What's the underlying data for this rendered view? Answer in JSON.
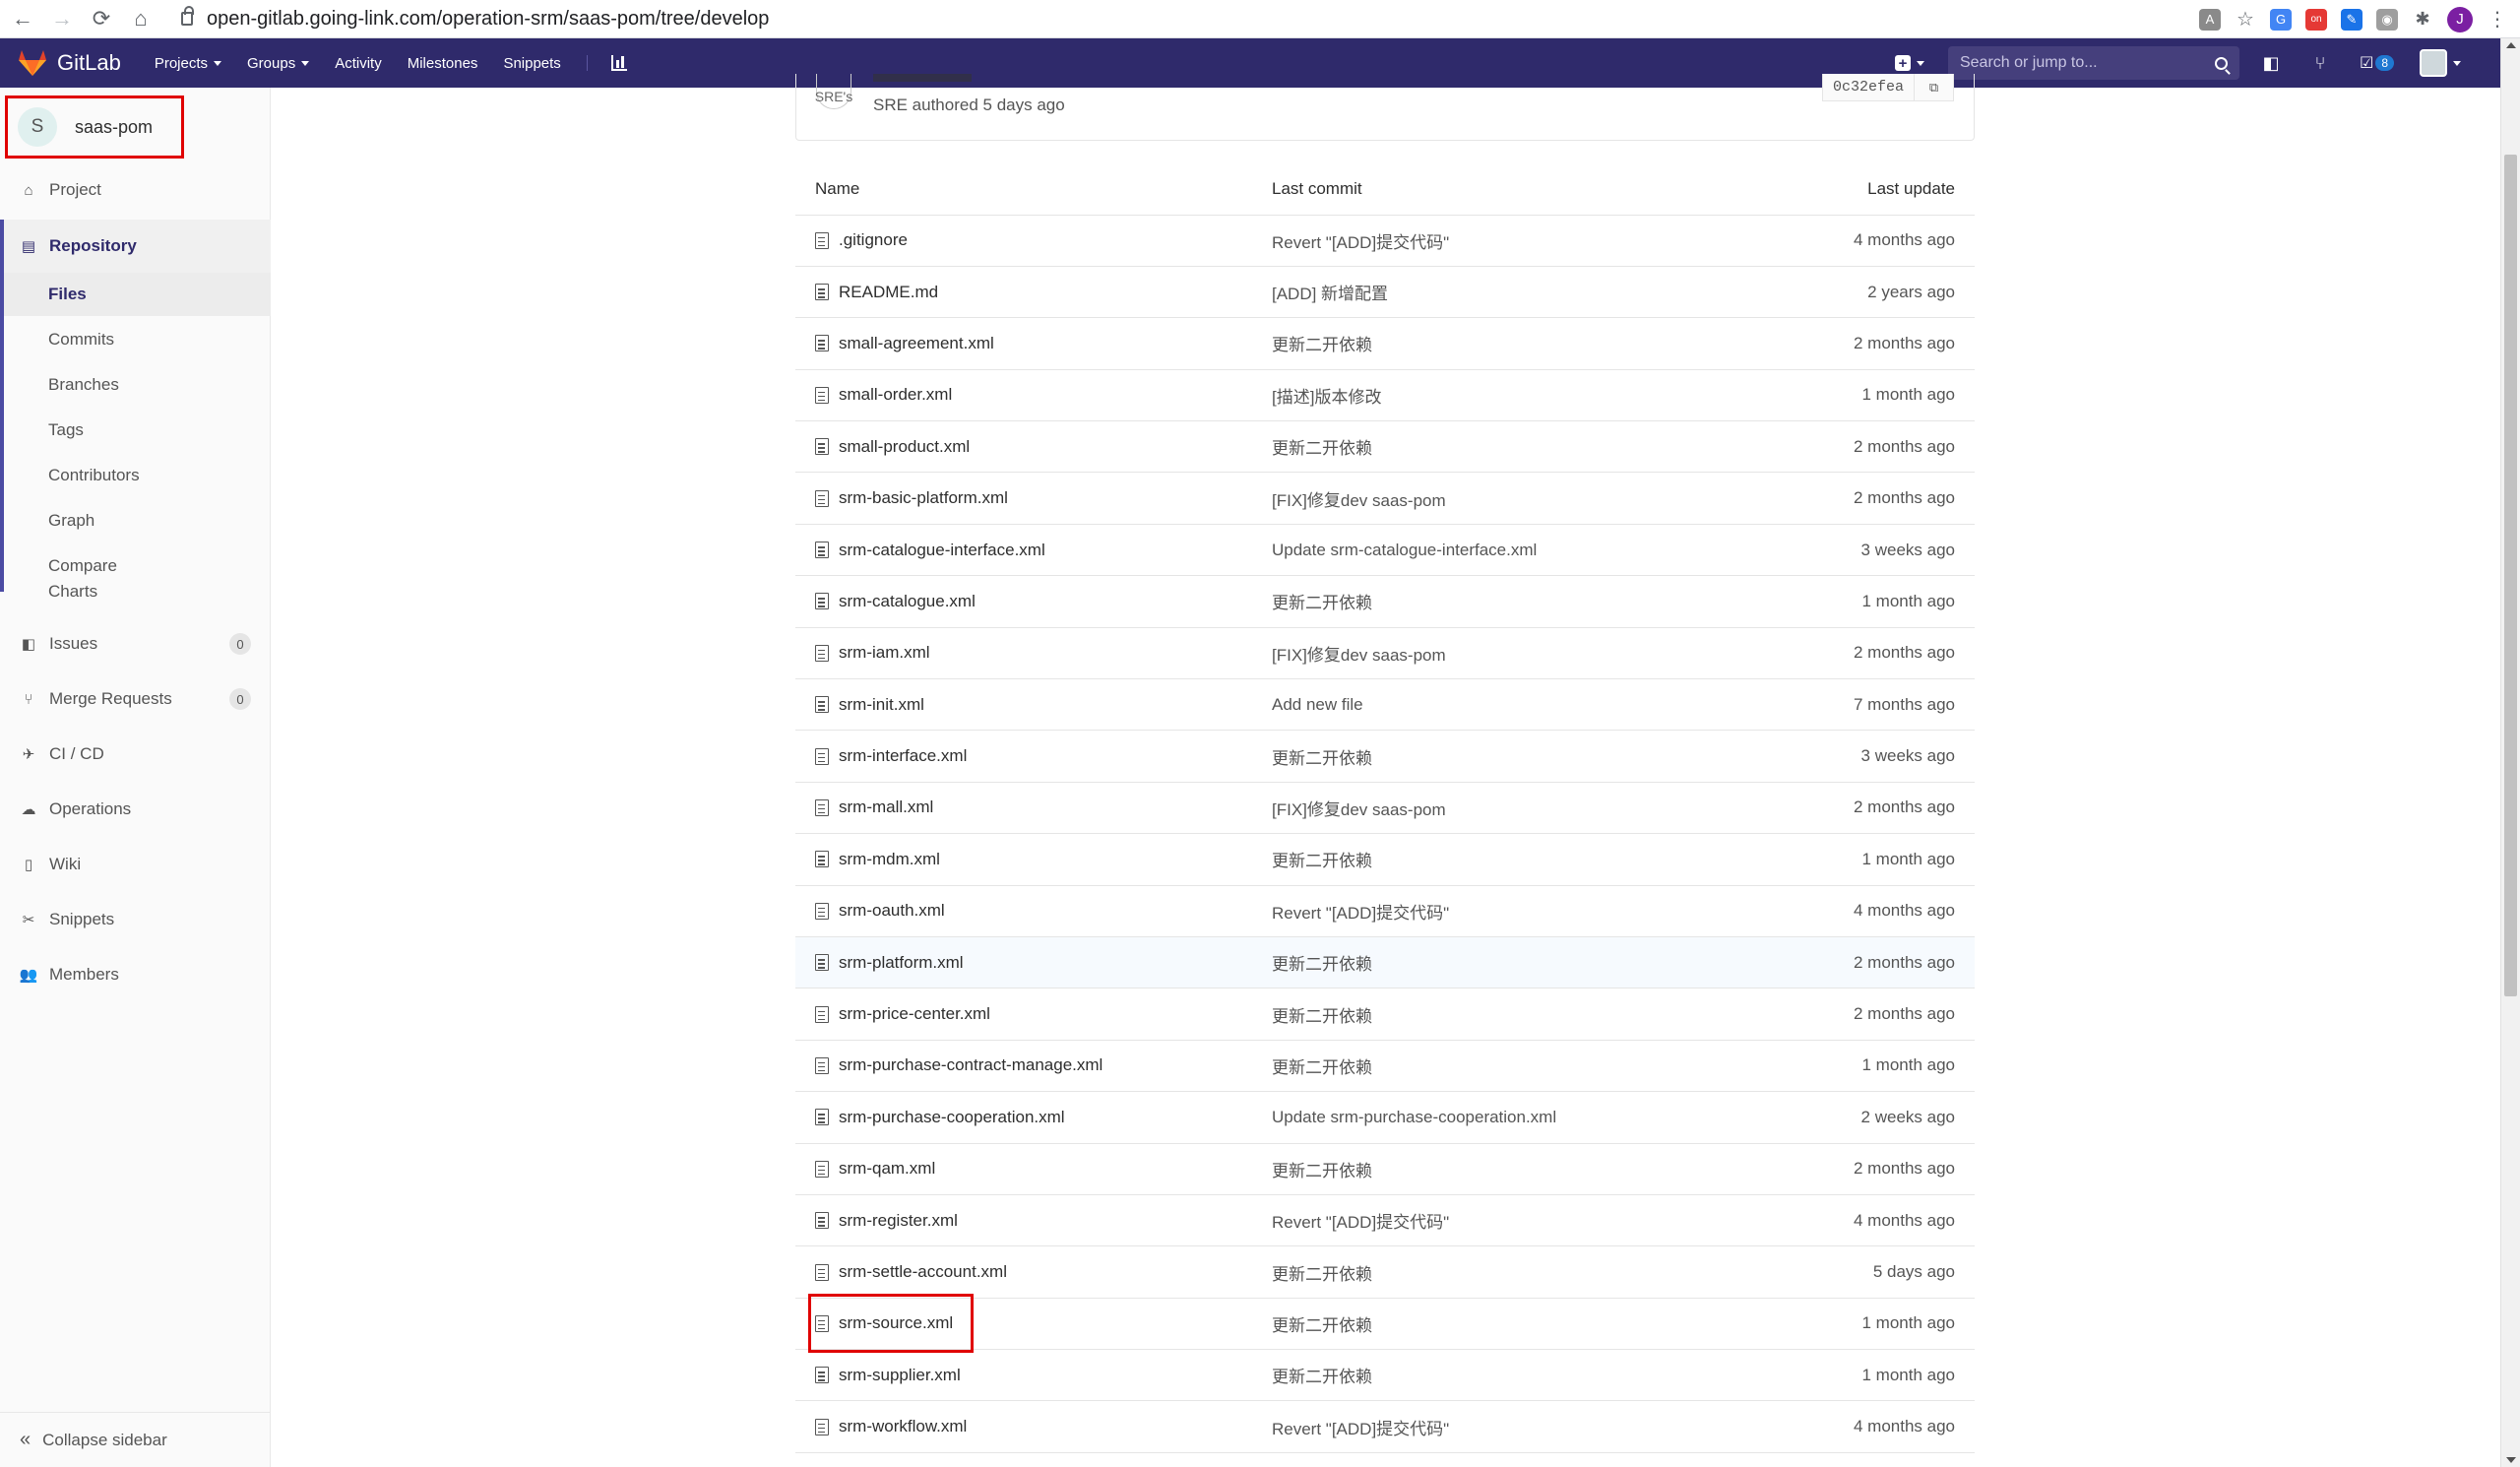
{
  "browser": {
    "back": "←",
    "forward": "→",
    "reload": "⟳",
    "home": "⌂",
    "url": "open-gitlab.going-link.com/operation-srm/saas-pom/tree/develop",
    "user_initial": "J"
  },
  "navbar": {
    "logo_text": "GitLab",
    "menu": [
      {
        "label": "Projects"
      },
      {
        "label": "Groups"
      },
      {
        "label": "Activity"
      },
      {
        "label": "Milestones"
      },
      {
        "label": "Snippets"
      }
    ],
    "search_placeholder": "Search or jump to...",
    "todo_count": "8",
    "brand_color": "#2f2a6b"
  },
  "sidebar": {
    "project_initial": "S",
    "project_name": "saas-pom",
    "items": {
      "project": "Project",
      "repository": "Repository",
      "issues": "Issues",
      "issues_count": "0",
      "merge_requests": "Merge Requests",
      "merge_requests_count": "0",
      "cicd": "CI / CD",
      "operations": "Operations",
      "wiki": "Wiki",
      "snippets": "Snippets",
      "members": "Members"
    },
    "repo_sub": [
      "Files",
      "Commits",
      "Branches",
      "Tags",
      "Contributors",
      "Graph",
      "Compare",
      "Charts"
    ],
    "collapse": "Collapse sidebar"
  },
  "commit": {
    "avatar": "SRE's",
    "meta": "SRE authored 5 days ago",
    "sha": "0c32efea"
  },
  "table": {
    "headers": {
      "name": "Name",
      "last_commit": "Last commit",
      "last_update": "Last update"
    },
    "rows": [
      {
        "name": ".gitignore",
        "commit": "Revert \"[ADD]提交代码\"",
        "updated": "4 months ago"
      },
      {
        "name": "README.md",
        "commit": "[ADD] 新增配置",
        "updated": "2 years ago"
      },
      {
        "name": "small-agreement.xml",
        "commit": "更新二开依赖",
        "updated": "2 months ago"
      },
      {
        "name": "small-order.xml",
        "commit": "[描述]版本修改",
        "updated": "1 month ago"
      },
      {
        "name": "small-product.xml",
        "commit": "更新二开依赖",
        "updated": "2 months ago"
      },
      {
        "name": "srm-basic-platform.xml",
        "commit": "[FIX]修复dev saas-pom",
        "updated": "2 months ago"
      },
      {
        "name": "srm-catalogue-interface.xml",
        "commit": "Update srm-catalogue-interface.xml",
        "updated": "3 weeks ago"
      },
      {
        "name": "srm-catalogue.xml",
        "commit": "更新二开依赖",
        "updated": "1 month ago"
      },
      {
        "name": "srm-iam.xml",
        "commit": "[FIX]修复dev saas-pom",
        "updated": "2 months ago"
      },
      {
        "name": "srm-init.xml",
        "commit": "Add new file",
        "updated": "7 months ago"
      },
      {
        "name": "srm-interface.xml",
        "commit": "更新二开依赖",
        "updated": "3 weeks ago"
      },
      {
        "name": "srm-mall.xml",
        "commit": "[FIX]修复dev saas-pom",
        "updated": "2 months ago"
      },
      {
        "name": "srm-mdm.xml",
        "commit": "更新二开依赖",
        "updated": "1 month ago"
      },
      {
        "name": "srm-oauth.xml",
        "commit": "Revert \"[ADD]提交代码\"",
        "updated": "4 months ago"
      },
      {
        "name": "srm-platform.xml",
        "commit": "更新二开依赖",
        "updated": "2 months ago"
      },
      {
        "name": "srm-price-center.xml",
        "commit": "更新二开依赖",
        "updated": "2 months ago"
      },
      {
        "name": "srm-purchase-contract-manage.xml",
        "commit": "更新二开依赖",
        "updated": "1 month ago"
      },
      {
        "name": "srm-purchase-cooperation.xml",
        "commit": "Update srm-purchase-cooperation.xml",
        "updated": "2 weeks ago"
      },
      {
        "name": "srm-qam.xml",
        "commit": "更新二开依赖",
        "updated": "2 months ago"
      },
      {
        "name": "srm-register.xml",
        "commit": "Revert \"[ADD]提交代码\"",
        "updated": "4 months ago"
      },
      {
        "name": "srm-settle-account.xml",
        "commit": "更新二开依赖",
        "updated": "5 days ago"
      },
      {
        "name": "srm-source.xml",
        "commit": "更新二开依赖",
        "updated": "1 month ago"
      },
      {
        "name": "srm-supplier.xml",
        "commit": "更新二开依赖",
        "updated": "1 month ago"
      },
      {
        "name": "srm-workflow.xml",
        "commit": "Revert \"[ADD]提交代码\"",
        "updated": "4 months ago"
      }
    ]
  }
}
